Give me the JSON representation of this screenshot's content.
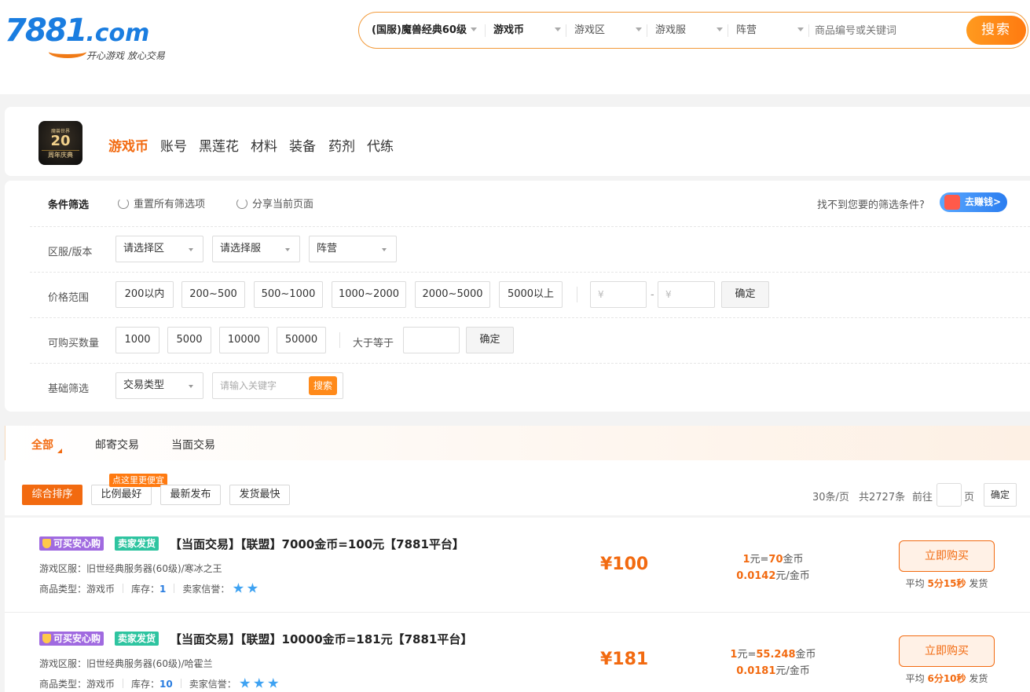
{
  "header": {
    "logo_text": "7881",
    "logo_suffix": ".com",
    "slogan": "开心游戏 放心交易",
    "search": {
      "game": "(国服)魔兽经典60级",
      "type": "游戏币",
      "zone": "游戏区",
      "server": "游戏服",
      "faction": "阵营",
      "placeholder": "商品编号或关键词",
      "button": "搜索"
    }
  },
  "category": {
    "icon_top": "魔兽世界",
    "icon_num": "20",
    "icon_bot": "周年庆典",
    "items": [
      "游戏币",
      "账号",
      "黑莲花",
      "材料",
      "装备",
      "药剂",
      "代练"
    ]
  },
  "filters": {
    "title": "条件筛选",
    "reset": "重置所有筛选项",
    "share": "分享当前页面",
    "not_found": "找不到您要的筛选条件?",
    "earn": "去赚钱>",
    "server_label": "区服/版本",
    "sel_zone": "请选择区",
    "sel_server": "请选择服",
    "sel_faction": "阵营",
    "price_label": "价格范围",
    "prices": [
      "200以内",
      "200~500",
      "500~1000",
      "1000~2000",
      "2000~5000",
      "5000以上"
    ],
    "yen": "¥",
    "dash": "-",
    "confirm": "确定",
    "qty_label": "可购买数量",
    "qtys": [
      "1000",
      "5000",
      "10000",
      "50000"
    ],
    "gte": "大于等于",
    "basic_label": "基础筛选",
    "trade_type": "交易类型",
    "kw_placeholder": "请输入关键字",
    "kw_search": "搜索"
  },
  "trade_tabs": [
    "全部",
    "邮寄交易",
    "当面交易"
  ],
  "sort": {
    "buttons": [
      "综合排序",
      "比例最好",
      "最新发布",
      "发货最快"
    ],
    "promo": "点这里更便宜",
    "per_page": "30条/页",
    "total": "共2727条",
    "goto": "前往",
    "page_unit": "页",
    "confirm": "确定"
  },
  "listings": [
    {
      "badge_safe": "可买安心购",
      "badge_seller": "卖家发货",
      "title": "【当面交易】【联盟】7000金币=100元【7881平台】",
      "server": "游戏区服：旧世经典服务器(60级)/寒冰之王",
      "type_label": "商品类型：",
      "type": "游戏币",
      "stock_label": "库存：",
      "stock": "1",
      "credit_label": "卖家信誉：",
      "stars": 2,
      "price": "¥100",
      "rate1_a": "1",
      "rate1_b": "元=",
      "rate1_c": "70",
      "rate1_d": "金币",
      "rate2_a": "0.0142",
      "rate2_b": "元/金币",
      "buy": "立即购买",
      "ship_a": "平均 ",
      "ship_b": "5分15秒",
      "ship_c": " 发货"
    },
    {
      "badge_safe": "可买安心购",
      "badge_seller": "卖家发货",
      "title": "【当面交易】【联盟】10000金币=181元【7881平台】",
      "server": "游戏区服：旧世经典服务器(60级)/哈霍兰",
      "type_label": "商品类型：",
      "type": "游戏币",
      "stock_label": "库存：",
      "stock": "10",
      "credit_label": "卖家信誉：",
      "stars": 3,
      "price": "¥181",
      "rate1_a": "1",
      "rate1_b": "元=",
      "rate1_c": "55.248",
      "rate1_d": "金币",
      "rate2_a": "0.0181",
      "rate2_b": "元/金币",
      "buy": "立即购买",
      "ship_a": "平均 ",
      "ship_b": "6分10秒",
      "ship_c": " 发货"
    }
  ]
}
